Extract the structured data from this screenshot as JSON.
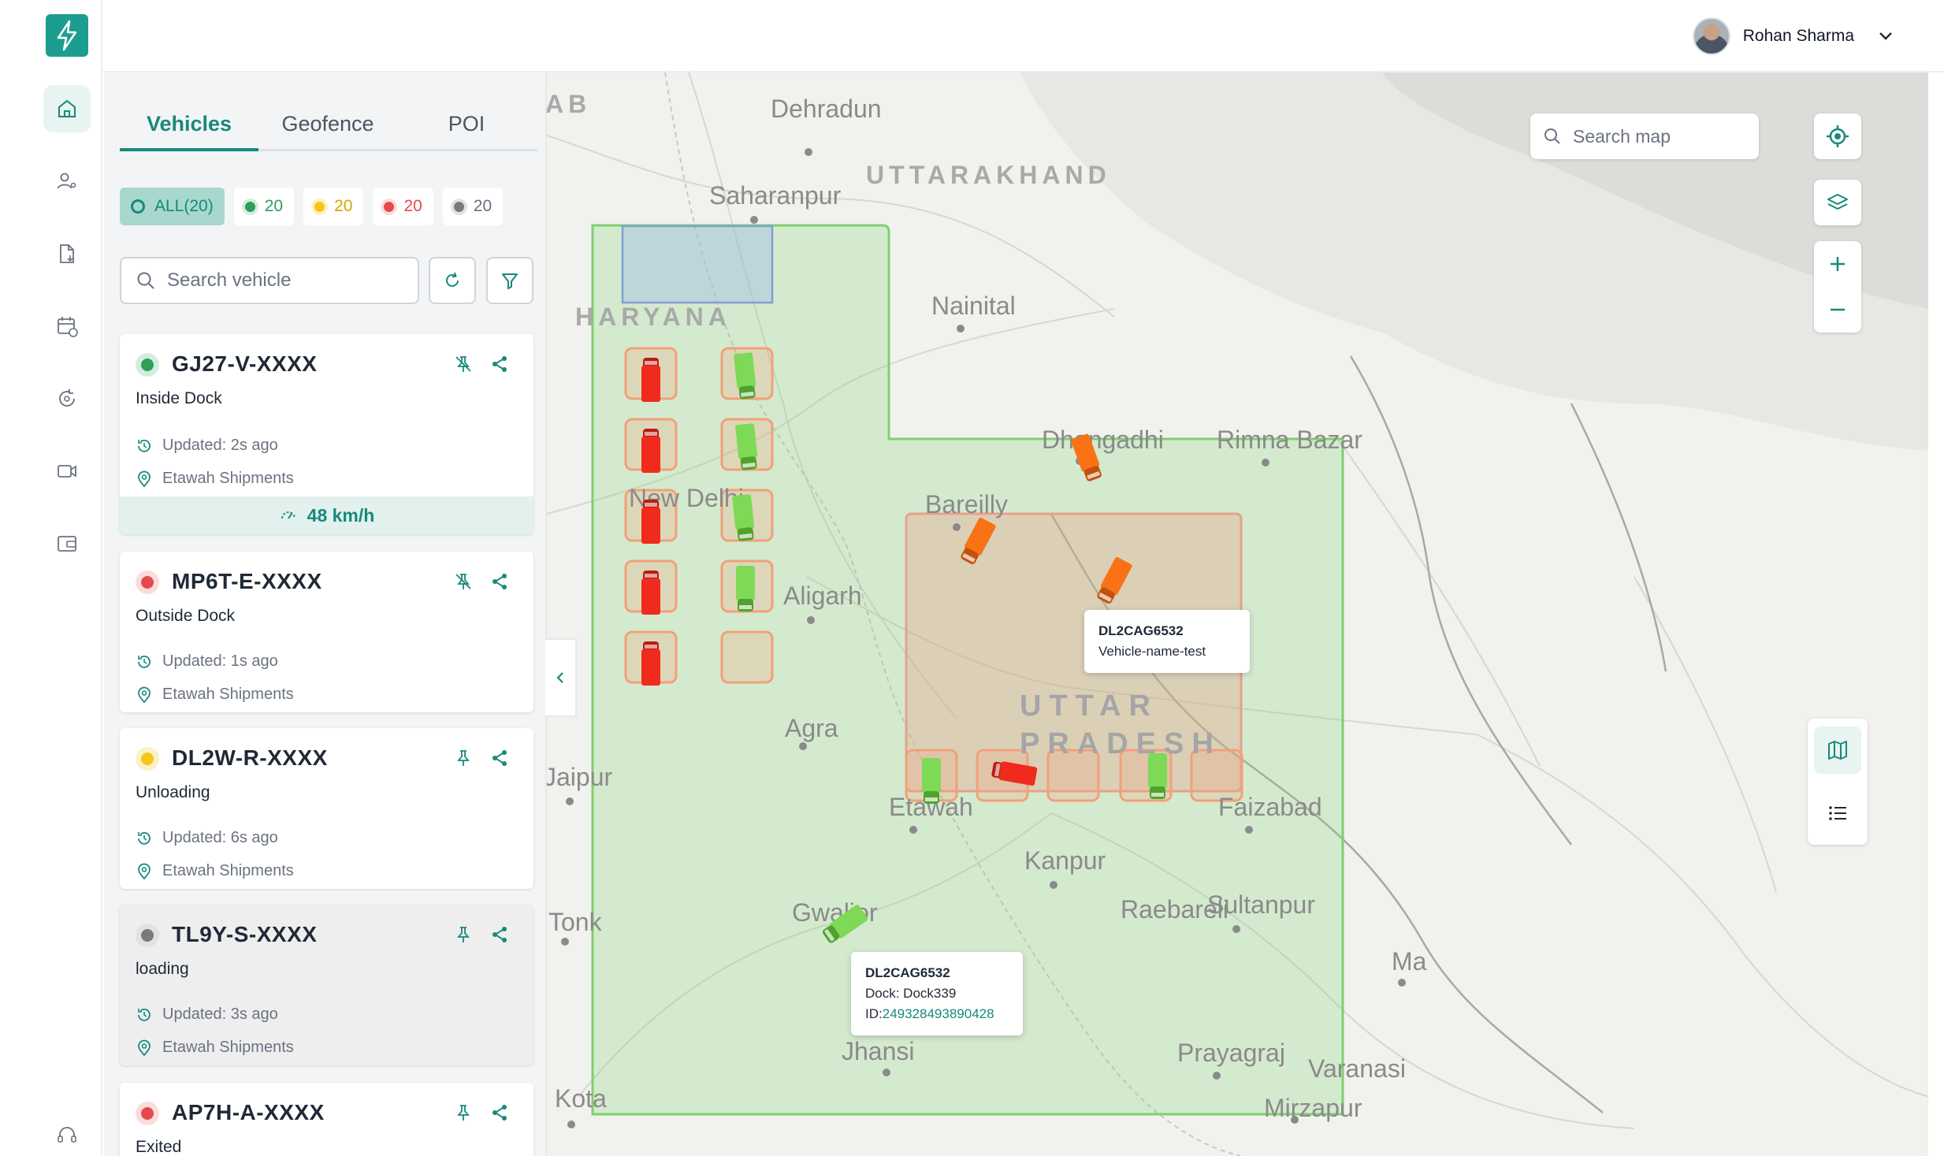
{
  "header": {
    "user_name": "Rohan Sharma",
    "avatar_icon": "user-avatar",
    "menu_icon": "chevron-down-icon"
  },
  "rail": {
    "logo_icon": "lightning-bolt-icon",
    "items": [
      {
        "name": "home",
        "icon": "home-icon",
        "active": true
      },
      {
        "name": "users",
        "icon": "user-settings-icon",
        "active": false
      },
      {
        "name": "documents",
        "icon": "document-download-icon",
        "active": false
      },
      {
        "name": "schedule",
        "icon": "calendar-clock-icon",
        "active": false
      },
      {
        "name": "routes",
        "icon": "route-refresh-icon",
        "active": false
      },
      {
        "name": "video",
        "icon": "video-icon",
        "active": false
      },
      {
        "name": "wallet",
        "icon": "wallet-icon",
        "active": false
      },
      {
        "name": "support",
        "icon": "headset-icon",
        "active": false
      }
    ]
  },
  "panel": {
    "tabs": [
      {
        "label": "Vehicles",
        "active": true
      },
      {
        "label": "Geofence",
        "active": false
      },
      {
        "label": "POI",
        "active": false
      }
    ],
    "filters": [
      {
        "label": "ALL(20)",
        "color": "#17897c",
        "active": true
      },
      {
        "label": "20",
        "color": "#2e9e5b",
        "active": false
      },
      {
        "label": "20",
        "color": "#f5c518",
        "active": false
      },
      {
        "label": "20",
        "color": "#e5484d",
        "active": false
      },
      {
        "label": "20",
        "color": "#7a7a7a",
        "active": false
      }
    ],
    "search_placeholder": "Search vehicle",
    "vehicles": [
      {
        "plate": "GJ27-V-XXXX",
        "state": "Inside Dock",
        "updated": "Updated: 2s ago",
        "location": "Etawah Shipments",
        "speed": "48 km/h",
        "status_color": "#2e9e5b",
        "halo": "#d4ece0",
        "pinned": false
      },
      {
        "plate": "MP6T-E-XXXX",
        "state": "Outside Dock",
        "updated": "Updated: 1s ago",
        "location": "Etawah Shipments",
        "status_color": "#e5484d",
        "halo": "#fbdcdc",
        "pinned": false
      },
      {
        "plate": "DL2W-R-XXXX",
        "state": "Unloading",
        "updated": "Updated: 6s ago",
        "location": "Etawah Shipments",
        "status_color": "#f5c518",
        "halo": "#fdf0c4",
        "pinned": true
      },
      {
        "plate": "TL9Y-S-XXXX",
        "state": "loading",
        "updated": "Updated: 3s ago",
        "location": "Etawah Shipments",
        "status_color": "#7a7a7a",
        "halo": "#e2e2e2",
        "pinned": true
      },
      {
        "plate": "AP7H-A-XXXX",
        "state": "Exited",
        "status_color": "#e5484d",
        "halo": "#fbdcdc",
        "pinned": true
      }
    ]
  },
  "map": {
    "search_placeholder": "Search map",
    "labels": {
      "ab": "AB",
      "dehradun": "Dehradun",
      "uttarakhand": "UTTARAKHAND",
      "saharanpur": "Saharanpur",
      "haryana": "HARYANA",
      "nainital": "Nainital",
      "dhangadhi": "Dhangadhi",
      "rimna": "Rimna Bazar",
      "bareilly": "Bareilly",
      "new_delhi": "New Delhi",
      "aligarh": "Aligarh",
      "agra": "Agra",
      "jaipur": "Jaipur",
      "up_line1": "UTTAR",
      "up_line2": "PRADESH",
      "etawah": "Etawah",
      "faizabad": "Faizabad",
      "kanpur": "Kanpur",
      "tonk": "Tonk",
      "gwalior": "Gwalior",
      "raebareli": "Raebareli",
      "sultanpur": "Sultanpur",
      "ma": "Ma",
      "jhansi": "Jhansi",
      "prayagraj": "Prayagraj",
      "varanasi": "Varanasi",
      "kota": "Kota",
      "mirzapur": "Mirzapur"
    },
    "tooltip_top": {
      "title": "DL2CAG6532",
      "line": "Vehicle-name-test"
    },
    "tooltip_bottom": {
      "title": "DL2CAG6532",
      "dock": "Dock: Dock339",
      "id_label": "ID:",
      "id_value": "249328493890428"
    },
    "colors": {
      "geofence": "#7fcf6e",
      "zone": "#e8a08a",
      "dock": "#f2a07a",
      "truck_red": "#f02b1d",
      "truck_green": "#7ed957",
      "truck_orange": "#f97316"
    }
  }
}
